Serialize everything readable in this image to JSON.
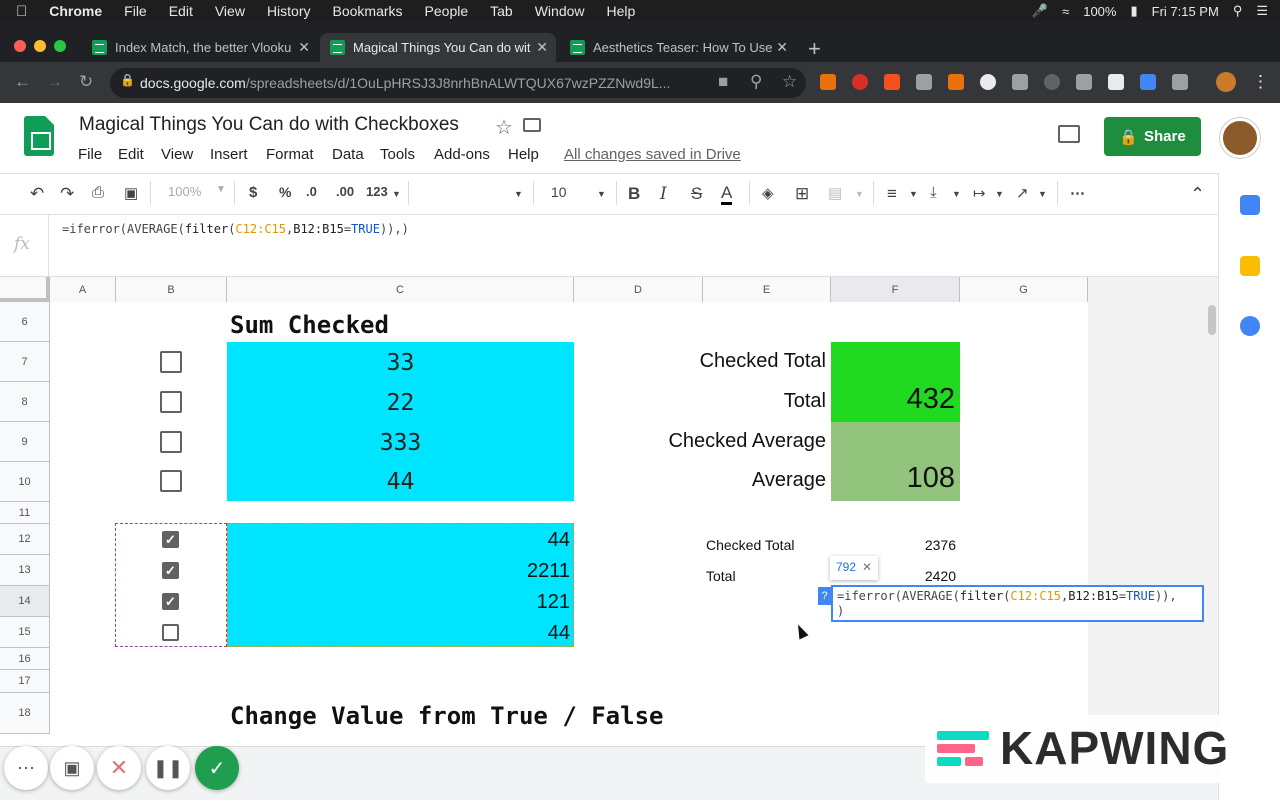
{
  "menubar": {
    "app": "Chrome",
    "items": [
      "File",
      "Edit",
      "View",
      "History",
      "Bookmarks",
      "People",
      "Tab",
      "Window",
      "Help"
    ],
    "battery": "100%",
    "clock": "Fri 7:15 PM"
  },
  "browser": {
    "tabs": [
      {
        "title": "Index Match, the better Vlooku",
        "active": false
      },
      {
        "title": "Magical Things You Can do wit",
        "active": true
      },
      {
        "title": "Aesthetics Teaser: How To Use",
        "active": false
      }
    ],
    "url_host": "docs.google.com",
    "url_path": "/spreadsheets/d/1OuLpHRSJ3J8nrhBnALWTQUX67wzPZZNwd9L..."
  },
  "doc": {
    "title": "Magical Things You Can do with Checkboxes",
    "menu": [
      "File",
      "Edit",
      "View",
      "Insert",
      "Format",
      "Data",
      "Tools",
      "Add-ons",
      "Help"
    ],
    "saved_status": "All changes saved in Drive",
    "share_label": "Share"
  },
  "toolbar": {
    "zoom": "100%",
    "currency": "$",
    "percent": "%",
    "dec_decrease": ".0",
    "dec_increase": ".00",
    "more_formats": "123",
    "font_size": "10",
    "bold": "B",
    "italic": "I",
    "strike": "S",
    "text_color": "A"
  },
  "formula_bar": {
    "label": "fx",
    "text": "=iferror(AVERAGE(filter(C12:C15,B12:B15=TRUE)),)"
  },
  "columns": [
    "A",
    "B",
    "C",
    "D",
    "E",
    "F",
    "G"
  ],
  "rows": [
    "6",
    "7",
    "8",
    "9",
    "10",
    "11",
    "12",
    "13",
    "14",
    "15",
    "16",
    "17",
    "18"
  ],
  "sheet": {
    "title1": "Sum Checked",
    "title2": "Change Value from True / False",
    "top_values": [
      "33",
      "22",
      "333",
      "44"
    ],
    "top_checks": [
      false,
      false,
      false,
      false
    ],
    "summary_labels": [
      "Checked Total",
      "Total",
      "Checked Average",
      "Average"
    ],
    "summary_values": [
      "",
      "432",
      "",
      "108"
    ],
    "bottom_values": [
      "44",
      "2211",
      "121",
      "44"
    ],
    "bottom_checks": [
      true,
      true,
      true,
      false
    ],
    "small_labels": [
      "Checked Total",
      "Total"
    ],
    "small_values": [
      "2376",
      "2420"
    ],
    "preview_value": "792",
    "help_badge": "?",
    "editor_line1_start": "=iferror(AVERAGE(",
    "editor_fn": "filter",
    "editor_range1": "C12:C15",
    "editor_range2": "B12:B15",
    "editor_true": "TRUE",
    "editor_end": ")),",
    "editor_line2": ")"
  },
  "watermark": "KAPWING",
  "colors": {
    "cyan": "#00e5ff",
    "bright_green": "#21d921",
    "muted_green": "#93c47d",
    "share_green": "#1e8e3e"
  }
}
